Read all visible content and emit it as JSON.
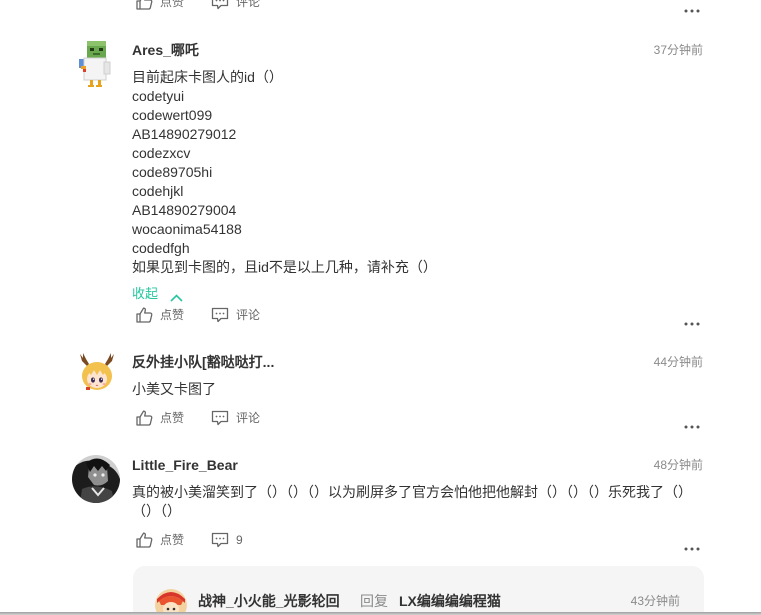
{
  "theme": {
    "accent": "#26c6a0",
    "text": "#333333",
    "muted": "#8a8a8a",
    "reply_bg": "#f5f5f5"
  },
  "icons": {
    "like": "thumbs-up-icon",
    "comment": "comment-bubble-icon",
    "more": "more-dots-icon",
    "collapse": "chevron-up-icon"
  },
  "previous_comment_actions": {
    "like_label": "点赞",
    "comment_label": "评论"
  },
  "comments": [
    {
      "username": "Ares_哪吒",
      "time": "37分钟前",
      "lines": [
        "目前起床卡图人的id（）",
        "codetyui",
        "codewert099",
        "AB14890279012",
        "codezxcv",
        "code89705hi",
        "codehjkl",
        "AB14890279004",
        "wocaonima54188",
        "codedfgh",
        "如果见到卡图的，且id不是以上几种，请补充（）"
      ],
      "collapse_label": "收起",
      "like_label": "点赞",
      "comment_label": "评论"
    },
    {
      "username": "反外挂小队[豁哒哒打...",
      "time": "44分钟前",
      "text": "小美又卡图了",
      "like_label": "点赞",
      "comment_label": "评论"
    },
    {
      "username": "Little_Fire_Bear",
      "time": "48分钟前",
      "text": "真的被小美溜笑到了（）（）（）以为刷屏多了官方会怕他把他解封（）（）（）乐死我了（）（）（）",
      "like_label": "点赞",
      "comment_count": "9",
      "reply": {
        "username": "战神_小火能_光影轮回",
        "reply_label": "回复",
        "reply_to": "LX编编编编程猫",
        "time": "43分钟前"
      }
    }
  ]
}
